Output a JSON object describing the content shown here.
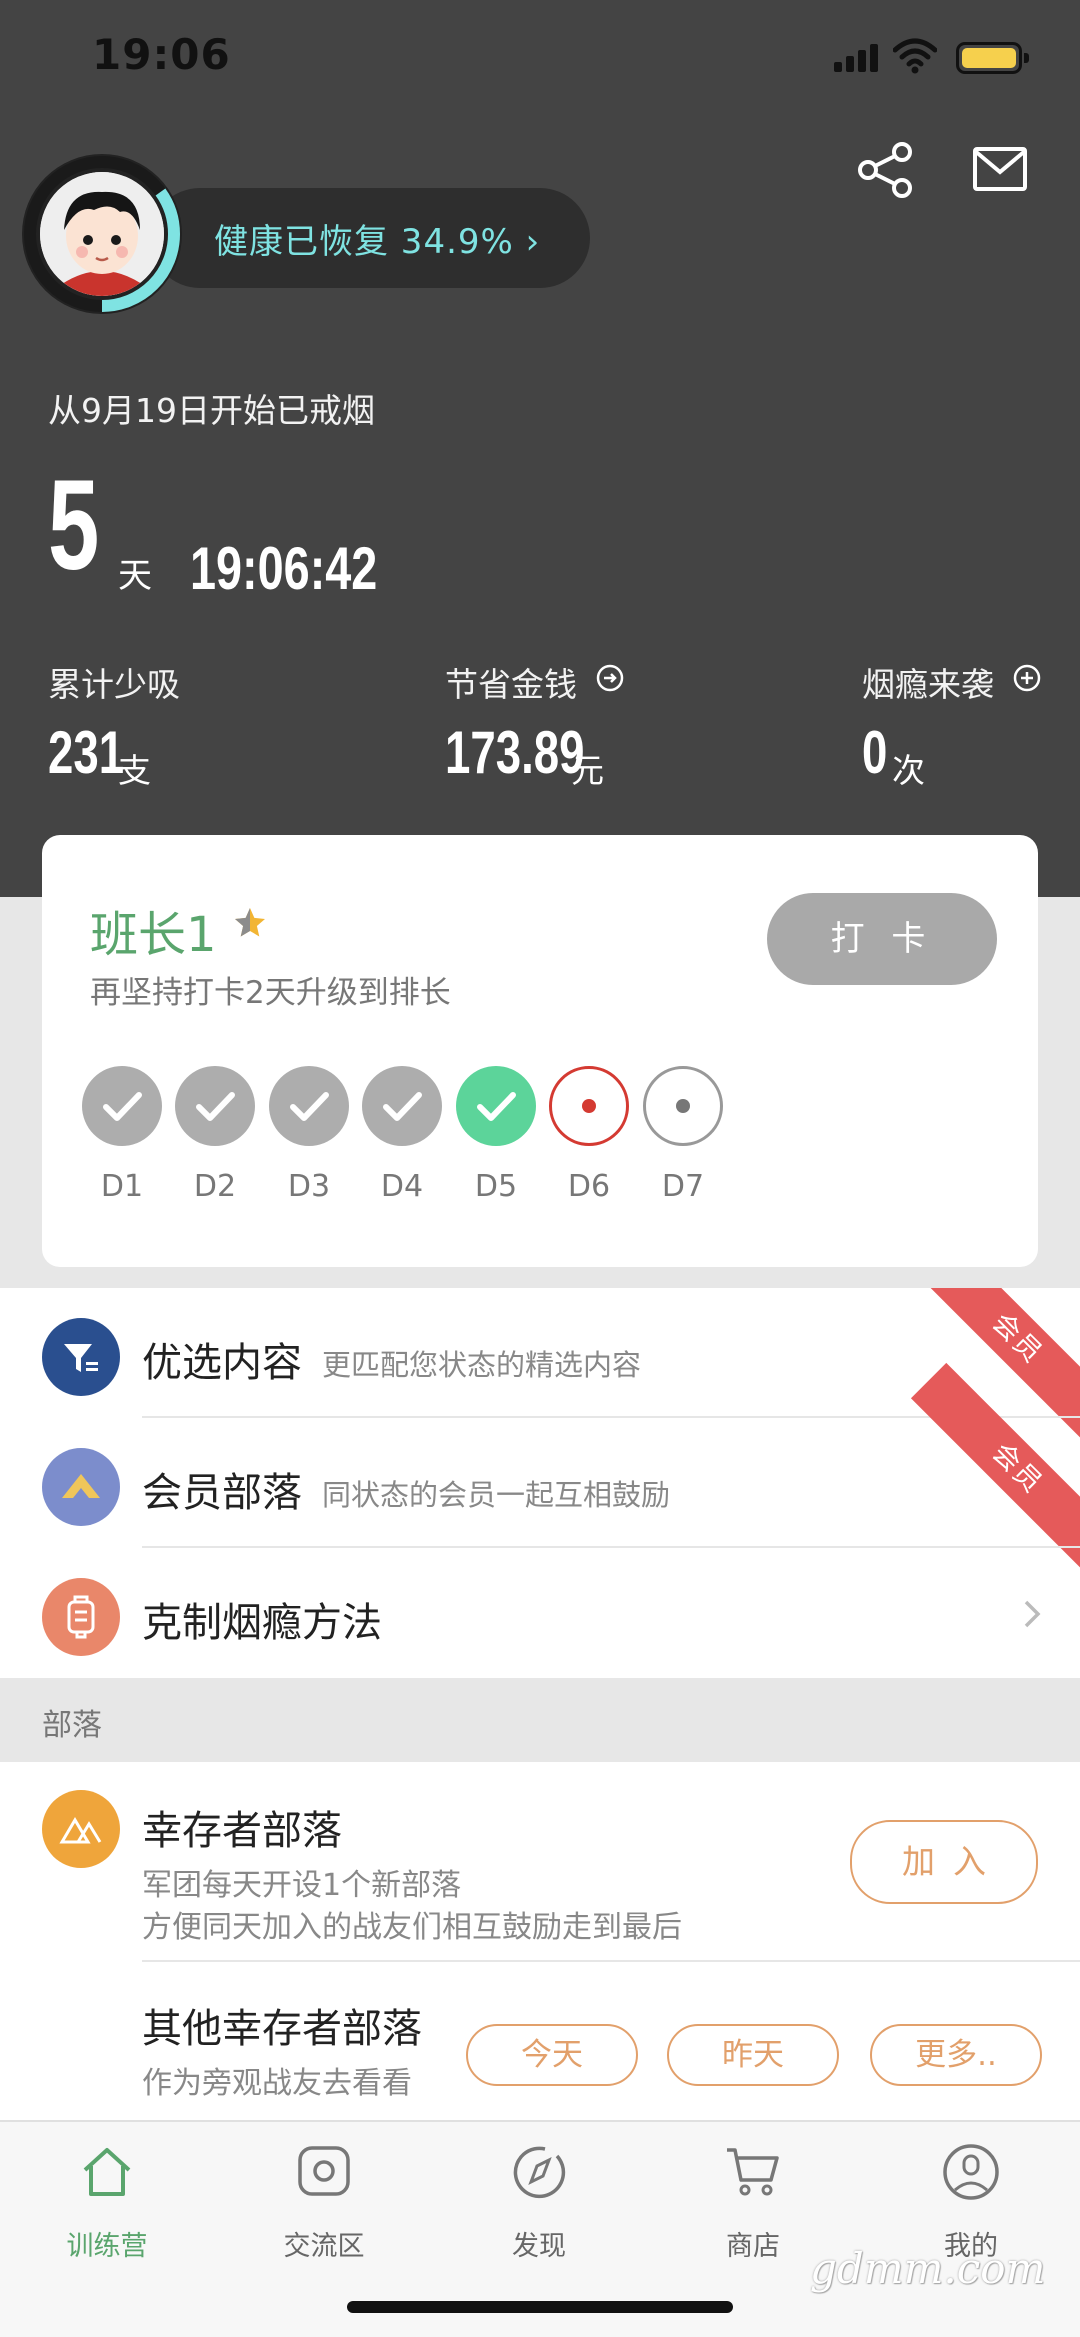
{
  "status_bar": {
    "time": "19:06"
  },
  "profile": {
    "health_text": "健康已恢复 34.9% ›",
    "health_progress_percent": 34.9
  },
  "quit": {
    "since_text": "从9月19日开始已戒烟",
    "days": "5",
    "days_unit": "天",
    "timer": "19:06:42"
  },
  "stats": [
    {
      "label": "累计少吸",
      "value": "231",
      "unit": "支",
      "icon": ""
    },
    {
      "label": "节省金钱",
      "value": "173.89",
      "unit": "元",
      "icon": "arrow-circle-icon"
    },
    {
      "label": "烟瘾来袭",
      "value": "0",
      "unit": "次",
      "icon": "plus-circle-icon"
    }
  ],
  "checkin": {
    "rank": "班长1",
    "subtitle": "再坚持打卡2天升级到排长",
    "button_label": "打 卡",
    "days": [
      {
        "label": "D1",
        "state": "done"
      },
      {
        "label": "D2",
        "state": "done"
      },
      {
        "label": "D3",
        "state": "done"
      },
      {
        "label": "D4",
        "state": "done"
      },
      {
        "label": "D5",
        "state": "today"
      },
      {
        "label": "D6",
        "state": "next"
      },
      {
        "label": "D7",
        "state": "future"
      }
    ]
  },
  "menu": [
    {
      "title": "优选内容",
      "desc": "更匹配您状态的精选内容",
      "badge": "会员",
      "icon_color": "#2a4f8f",
      "icon": "filter-icon"
    },
    {
      "title": "会员部落",
      "desc": "同状态的会员一起互相鼓励",
      "badge": "会员",
      "icon_color": "#7c8dcc",
      "icon": "mountain-icon"
    },
    {
      "title": "克制烟瘾方法",
      "desc": "",
      "badge": "",
      "icon_color": "#e9876a",
      "icon": "lantern-icon"
    }
  ],
  "tribe_section": {
    "header": "部落",
    "survivor": {
      "title": "幸存者部落",
      "desc1": "军团每天开设1个新部落",
      "desc2": "方便同天加入的战友们相互鼓励走到最后",
      "join_label": "加入"
    },
    "other": {
      "title": "其他幸存者部落",
      "desc": "作为旁观战友去看看",
      "buttons": [
        "今天",
        "昨天",
        "更多.."
      ]
    }
  },
  "tabs": [
    {
      "label": "训练营",
      "icon": "home-icon",
      "active": true
    },
    {
      "label": "交流区",
      "icon": "chat-icon",
      "active": false
    },
    {
      "label": "发现",
      "icon": "compass-icon",
      "active": false
    },
    {
      "label": "商店",
      "icon": "cart-icon",
      "active": false
    },
    {
      "label": "我的",
      "icon": "profile-icon",
      "active": false
    }
  ],
  "watermark": "gdmm.com",
  "colors": {
    "header_bg": "#444444",
    "accent_green": "#5aa56d",
    "health_cyan": "#7fe3e2",
    "today_green": "#5cd49a",
    "orange_outline": "#e2a06b",
    "ribbon_red": "#e55a5a"
  }
}
